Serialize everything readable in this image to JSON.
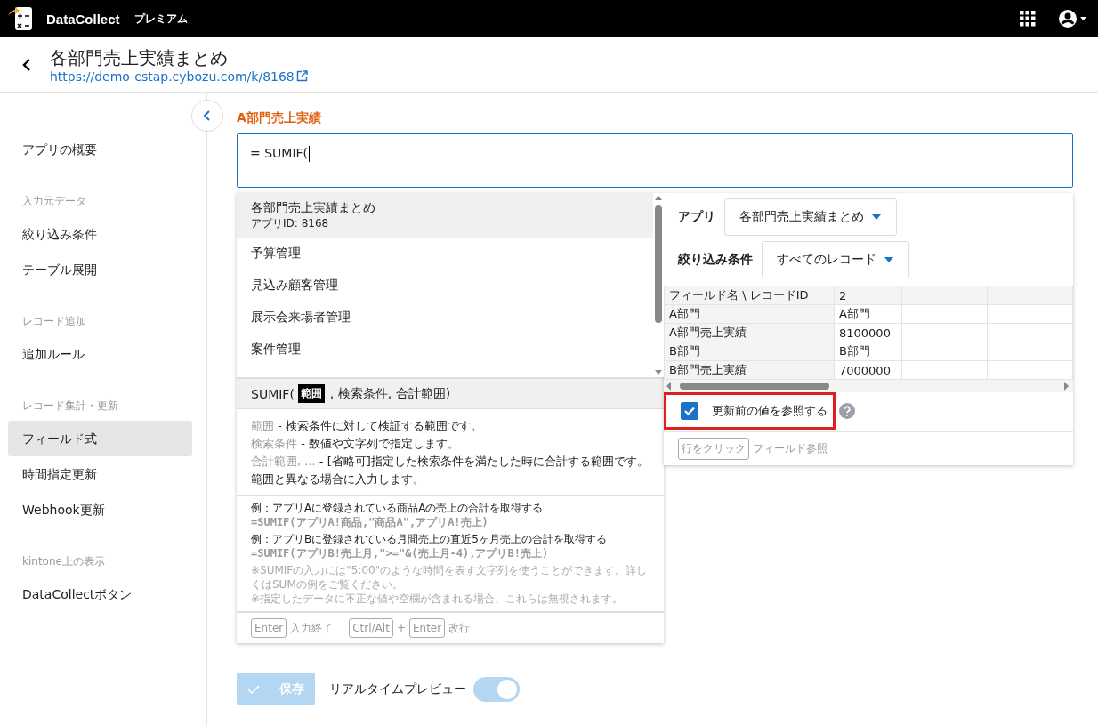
{
  "header": {
    "app_name": "DataCollect",
    "edition": "プレミアム"
  },
  "page": {
    "title": "各部門売上実績まとめ",
    "url": "https://demo-cstap.cybozu.com/k/8168"
  },
  "sidebar": {
    "items": [
      {
        "kind": "item",
        "label": "アプリの概要",
        "selected": false
      },
      {
        "kind": "section",
        "label": "入力元データ"
      },
      {
        "kind": "item",
        "label": "絞り込み条件",
        "selected": false
      },
      {
        "kind": "item",
        "label": "テーブル展開",
        "selected": false
      },
      {
        "kind": "section",
        "label": "レコード追加"
      },
      {
        "kind": "item",
        "label": "追加ルール",
        "selected": false
      },
      {
        "kind": "section",
        "label": "レコード集計・更新"
      },
      {
        "kind": "item",
        "label": "フィールド式",
        "selected": true
      },
      {
        "kind": "item",
        "label": "時間指定更新",
        "selected": false
      },
      {
        "kind": "item",
        "label": "Webhook更新",
        "selected": false
      },
      {
        "kind": "section",
        "label": "kintone上の表示"
      },
      {
        "kind": "item",
        "label": "DataCollectボタン",
        "selected": false
      }
    ]
  },
  "field": {
    "label": "A部門売上実績",
    "value": "= SUMIF("
  },
  "app_list": [
    {
      "name": "各部門売上実績まとめ",
      "subtitle": "アプリID: 8168",
      "selected": true
    },
    {
      "name": "予算管理",
      "selected": false
    },
    {
      "name": "見込み顧客管理",
      "selected": false
    },
    {
      "name": "展示会来場者管理",
      "selected": false
    },
    {
      "name": "案件管理",
      "selected": false
    }
  ],
  "signature": {
    "prefix": "SUMIF(",
    "active_arg": "範囲",
    "rest": ", 検索条件, 合計範囲)"
  },
  "description": [
    {
      "term": "範囲",
      "text": " - 検索条件に対して検証する範囲です。"
    },
    {
      "term": "検索条件",
      "text": " - 数値や文字列で指定します。"
    },
    {
      "term": "合計範囲, ...",
      "text": " - [省略可]指定した検索条件を満たした時に合計する範囲です。範囲と異なる場合に入力します。"
    }
  ],
  "examples": [
    {
      "caption": "例：アプリAに登録されている商品Aの売上の合計を取得する",
      "formula": "=SUMIF(アプリA!商品,\"商品A\",アプリA!売上)"
    },
    {
      "caption": "例：アプリBに登録されている月間売上の直近5ヶ月売上の合計を取得する",
      "formula": "=SUMIF(アプリB!売上月,\">=\"&(売上月-4),アプリB!売上)"
    }
  ],
  "notes": [
    "※SUMIFの入力には\"5:00\"のような時間を表す文字列を使うことができます。詳しくはSUMの例をご覧ください。",
    "※指定したデータに不正な値や空欄が含まれる場合、これらは無視されます。"
  ],
  "shortcuts": [
    {
      "keys": [
        "Enter"
      ],
      "label": "入力終了"
    },
    {
      "keys": [
        "Ctrl/Alt",
        "Enter"
      ],
      "joiner": "+",
      "label": "改行"
    }
  ],
  "preview": {
    "app_label": "アプリ",
    "app_value": "各部門売上実績まとめ",
    "filter_label": "絞り込み条件",
    "filter_value": "すべてのレコード",
    "table": {
      "columns": [
        "フィールド名 \\ レコードID",
        "2"
      ],
      "rows": [
        [
          "A部門",
          "A部門"
        ],
        [
          "A部門売上実績",
          "8100000"
        ],
        [
          "B部門",
          "B部門"
        ],
        [
          "B部門売上実績",
          "7000000"
        ]
      ]
    },
    "checkbox": {
      "label": "更新前の値を参照する",
      "checked": true,
      "highlighted": true
    },
    "hint": {
      "key": "行をクリック",
      "text": "フィールド参照"
    }
  },
  "footer": {
    "save_label": "保存",
    "save_disabled": true,
    "realtime_label": "リアルタイムプレビュー",
    "realtime_on": true
  }
}
